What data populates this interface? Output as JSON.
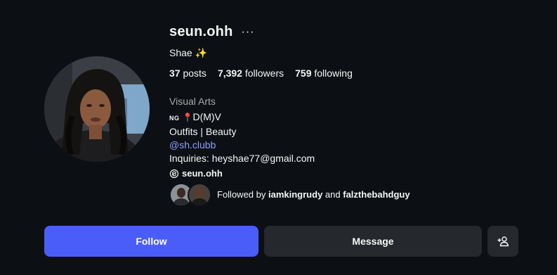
{
  "profile": {
    "username": "seun.ohh",
    "more_icon": "···",
    "full_name": "Shae ✨",
    "stats": {
      "posts_count": "37",
      "posts_label": "posts",
      "followers_count": "7,392",
      "followers_label": "followers",
      "following_count": "759",
      "following_label": "following"
    },
    "bio": {
      "category": "Visual Arts",
      "flag_code": "NG",
      "pin_icon": "📍",
      "location": "D(M)V",
      "line2": "Outfits | Beauty",
      "link": "@sh.clubb",
      "inquiries": "Inquiries: heyshae77@gmail.com",
      "threads_handle": "seun.ohh"
    },
    "followed_by": {
      "prefix": "Followed by",
      "user1": "iamkingrudy",
      "joiner": "and",
      "user2": "falzthebahdguy"
    }
  },
  "actions": {
    "follow": "Follow",
    "message": "Message",
    "suggest_icon": "person-add-icon"
  },
  "colors": {
    "background": "#0c1014",
    "follow_button": "#4a5df9",
    "secondary_button": "#25292e",
    "link": "#8c9eff",
    "muted_text": "#a8a8a8"
  }
}
